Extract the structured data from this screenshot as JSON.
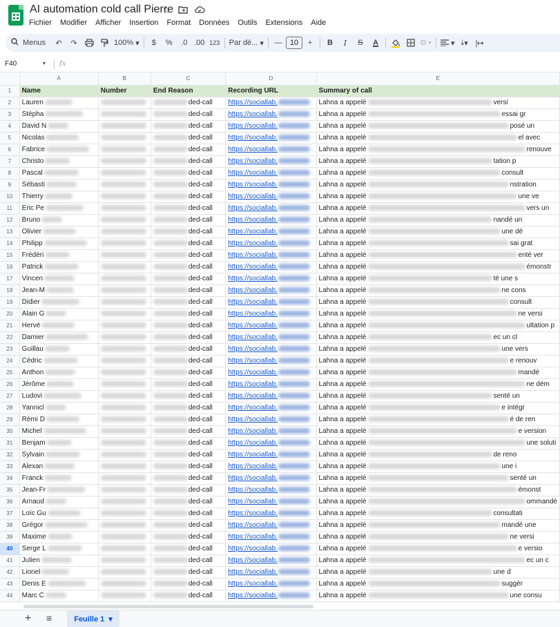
{
  "app": {
    "title": "AI automation cold call Pierre",
    "menus": [
      "Fichier",
      "Modifier",
      "Afficher",
      "Insertion",
      "Format",
      "Données",
      "Outils",
      "Extensions",
      "Aide"
    ]
  },
  "toolbar": {
    "search_label": "Menus",
    "zoom": "100%",
    "currency": "$",
    "percent": "%",
    "decrease_decimals": ".0",
    "increase_decimals": ".00",
    "number_format": "123",
    "font": "Par dé...",
    "font_size": "10"
  },
  "formula_bar": {
    "cell_ref": "F40",
    "fx": "fx"
  },
  "sheet": {
    "columns": [
      "A",
      "B",
      "C",
      "D",
      "E"
    ],
    "active_row": 40,
    "header": {
      "row_number": "1",
      "cells": [
        "Name",
        "Number",
        "End Reason",
        "Recording URL",
        "Summary of call"
      ]
    },
    "rows": [
      {
        "n": "2",
        "name": "Lauren",
        "end": "ded-call",
        "url": "https://sociallab.",
        "summary": "Lahna a appelé",
        "tail": "versi"
      },
      {
        "n": "3",
        "name": "Stépha",
        "end": "ded-call",
        "url": "https://sociallab.",
        "summary": "Lahna a appelé",
        "tail": "essai gr"
      },
      {
        "n": "4",
        "name": "David N",
        "end": "ded-call",
        "url": "https://sociallab.",
        "summary": "Lahna a appelé",
        "tail": "posé un"
      },
      {
        "n": "5",
        "name": "Nicolas",
        "end": "ded-call",
        "url": "https://sociallab.",
        "summary": "Lahna a appelé",
        "tail": "el avec"
      },
      {
        "n": "6",
        "name": "Fabrice",
        "end": "ded-call",
        "url": "https://sociallab.",
        "summary": "Lahna a appelé",
        "tail": "renouve"
      },
      {
        "n": "7",
        "name": "Christo",
        "end": "ded-call",
        "url": "https://sociallab.",
        "summary": "Lahna a appelé",
        "tail": "tation p"
      },
      {
        "n": "8",
        "name": "Pascal",
        "end": "ded-call",
        "url": "https://sociallab.",
        "summary": "Lahna a appelé",
        "tail": "consult"
      },
      {
        "n": "9",
        "name": "Sébasti",
        "end": "ded-call",
        "url": "https://sociallab.",
        "summary": "Lahna a appelé",
        "tail": "nstration"
      },
      {
        "n": "10",
        "name": "Thierry",
        "end": "ded-call",
        "url": "https://sociallab.",
        "summary": "Lahna a appelé",
        "tail": "une ve"
      },
      {
        "n": "11",
        "name": "Eric Pe",
        "end": "ded-call",
        "url": "https://sociallab.",
        "summary": "Lahna a appelé",
        "tail": "vers un"
      },
      {
        "n": "12",
        "name": "Bruno",
        "end": "ded-call",
        "url": "https://sociallab.",
        "summary": "Lahna a appelé",
        "tail": "nandé un"
      },
      {
        "n": "13",
        "name": "Olivier",
        "end": "ded-call",
        "url": "https://sociallab.",
        "summary": "Lahna a appelé",
        "tail": "une dé"
      },
      {
        "n": "14",
        "name": "Philipp",
        "end": "ded-call",
        "url": "https://sociallab.",
        "summary": "Lahna a appelé",
        "tail": "sai grat"
      },
      {
        "n": "15",
        "name": "Frédéri",
        "end": "ded-call",
        "url": "https://sociallab.",
        "summary": "Lahna a appelé",
        "tail": "enté ver"
      },
      {
        "n": "16",
        "name": "Patrick",
        "end": "ded-call",
        "url": "https://sociallab.",
        "summary": "Lahna a appelé",
        "tail": "émonstr"
      },
      {
        "n": "17",
        "name": "Vincen",
        "end": "ded-call",
        "url": "https://sociallab.",
        "summary": "Lahna a appelé",
        "tail": "té une s"
      },
      {
        "n": "18",
        "name": "Jean-M",
        "end": "ded-call",
        "url": "https://sociallab.",
        "summary": "Lahna a appelé",
        "tail": "ne cons"
      },
      {
        "n": "19",
        "name": "Didier",
        "end": "ded-call",
        "url": "https://sociallab.",
        "summary": "Lahna a appelé",
        "tail": "consult"
      },
      {
        "n": "20",
        "name": "Alain G",
        "end": "ded-call",
        "url": "https://sociallab.",
        "summary": "Lahna a appelé",
        "tail": "ne versi"
      },
      {
        "n": "21",
        "name": "Hervé",
        "end": "ded-call",
        "url": "https://sociallab.",
        "summary": "Lahna a appelé",
        "tail": "ultation p"
      },
      {
        "n": "22",
        "name": "Damier",
        "end": "ded-call",
        "url": "https://sociallab.",
        "summary": "Lahna a appelé",
        "tail": "ec un cl"
      },
      {
        "n": "23",
        "name": "Guillau",
        "end": "ded-call",
        "url": "https://sociallab.",
        "summary": "Lahna a appelé",
        "tail": "une vers"
      },
      {
        "n": "24",
        "name": "Cédric",
        "end": "ded-call",
        "url": "https://sociallab.",
        "summary": "Lahna a appelé",
        "tail": "e renouv"
      },
      {
        "n": "25",
        "name": "Anthon",
        "end": "ded-call",
        "url": "https://sociallab.",
        "summary": "Lahna a appelé",
        "tail": "mandé"
      },
      {
        "n": "26",
        "name": "Jérôme",
        "end": "ded-call",
        "url": "https://sociallab.",
        "summary": "Lahna a appelé",
        "tail": "ne dém"
      },
      {
        "n": "27",
        "name": "Ludovi",
        "end": "ded-call",
        "url": "https://sociallab.",
        "summary": "Lahna a appelé",
        "tail": "senté un"
      },
      {
        "n": "28",
        "name": "Yannicl",
        "end": "ded-call",
        "url": "https://sociallab.",
        "summary": "Lahna a appelé",
        "tail": "e intégr"
      },
      {
        "n": "29",
        "name": "Rémi D",
        "end": "ded-call",
        "url": "https://sociallab.",
        "summary": "Lahna a appelé",
        "tail": "é de ren"
      },
      {
        "n": "30",
        "name": "Michel",
        "end": "ded-call",
        "url": "https://sociallab.",
        "summary": "Lahna a appelé",
        "tail": "e version"
      },
      {
        "n": "31",
        "name": "Benjam",
        "end": "ded-call",
        "url": "https://sociallab.",
        "summary": "Lahna a appelé",
        "tail": "une soluti"
      },
      {
        "n": "32",
        "name": "Sylvain",
        "end": "ded-call",
        "url": "https://sociallab.",
        "summary": "Lahna a appelé",
        "tail": "de reno"
      },
      {
        "n": "33",
        "name": "Alexan",
        "end": "ded-call",
        "url": "https://sociallab.",
        "summary": "Lahna a appelé",
        "tail": "une i"
      },
      {
        "n": "34",
        "name": "Franck",
        "end": "ded-call",
        "url": "https://sociallab.",
        "summary": "Lahna a appelé",
        "tail": "senté un"
      },
      {
        "n": "35",
        "name": "Jean-Fr",
        "end": "ded-call",
        "url": "https://sociallab.",
        "summary": "Lahna a appelé",
        "tail": "émonst"
      },
      {
        "n": "36",
        "name": "Arnaud",
        "end": "ded-call",
        "url": "https://sociallab.",
        "summary": "Lahna a appelé",
        "tail": "ommandé"
      },
      {
        "n": "37",
        "name": "Loïc Gu",
        "end": "ded-call",
        "url": "https://sociallab.",
        "summary": "Lahna a appelé",
        "tail": "consultati"
      },
      {
        "n": "38",
        "name": "Grégor",
        "end": "ded-call",
        "url": "https://sociallab.",
        "summary": "Lahna a appelé",
        "tail": "mandé une"
      },
      {
        "n": "39",
        "name": "Maxime",
        "end": "ded-call",
        "url": "https://sociallab.",
        "summary": "Lahna a appelé",
        "tail": "ne versi"
      },
      {
        "n": "40",
        "name": "Serge L",
        "end": "ded-call",
        "url": "https://sociallab.",
        "summary": "Lahna a appelé",
        "tail": "e versio"
      },
      {
        "n": "41",
        "name": "Julien",
        "end": "ded-call",
        "url": "https://sociallab.",
        "summary": "Lahna a appelé",
        "tail": "ec un c"
      },
      {
        "n": "42",
        "name": "Lionel",
        "end": "ded-call",
        "url": "https://sociallab.",
        "summary": "Lahna a appelé",
        "tail": "une d"
      },
      {
        "n": "43",
        "name": "Denis E",
        "end": "ded-call",
        "url": "https://sociallab.",
        "summary": "Lahna a appelé",
        "tail": "suggér"
      },
      {
        "n": "44",
        "name": "Marc C",
        "end": "ded-call",
        "url": "https://sociallab.",
        "summary": "Lahna a appelé",
        "tail": "une consu"
      }
    ]
  },
  "footer": {
    "add_sheet": "+",
    "all_sheets": "≡",
    "active_tab": "Feuille 1"
  },
  "colors": {
    "header_fill": "#d9ead3",
    "link": "#1155cc",
    "active_tab": "#0b57d0",
    "sheets_brand": "#0f9d58"
  },
  "icons": [
    "sheets-logo-icon",
    "star-icon",
    "move-folder-icon",
    "cloud-status-icon",
    "search-icon",
    "undo-icon",
    "redo-icon",
    "print-icon",
    "paint-format-icon",
    "text-color-icon",
    "fill-color-icon",
    "borders-icon",
    "merge-cells-icon",
    "align-left-icon",
    "valign-bottom-icon",
    "chevron-down-icon"
  ]
}
